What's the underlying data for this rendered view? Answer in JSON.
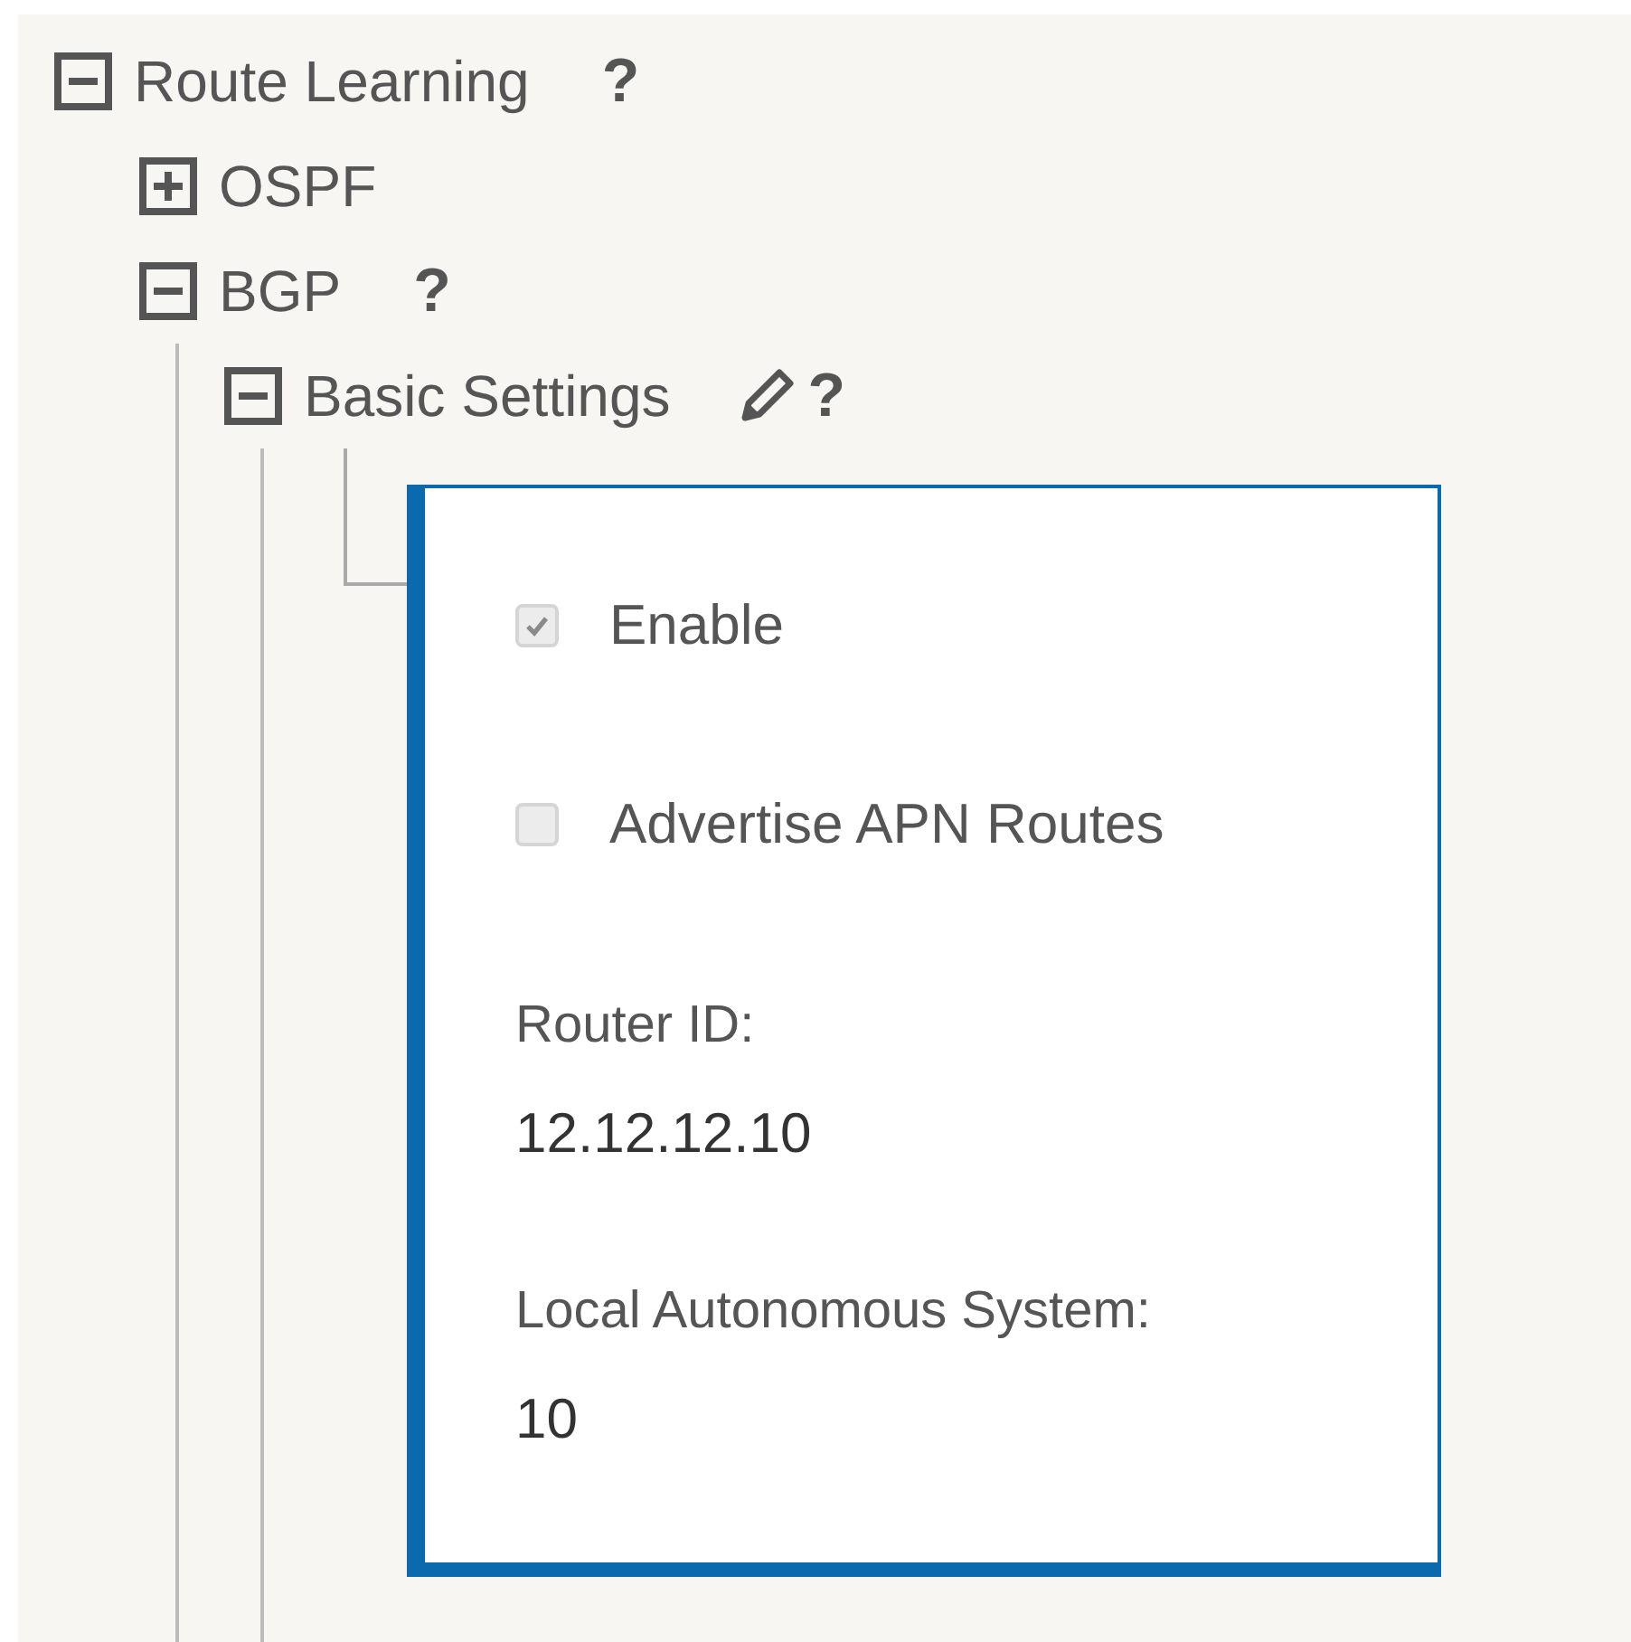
{
  "tree": [
    {
      "label": "Route Learning",
      "expanded": true,
      "help": "?",
      "children": [
        {
          "label": "OSPF",
          "expanded": false
        },
        {
          "label": "BGP",
          "expanded": true,
          "help": "?",
          "children": [
            {
              "label": "Basic Settings",
              "expanded": true,
              "editable": true,
              "help": "?",
              "panel": {
                "fields": [
                  {
                    "kind": "checkbox",
                    "label": "Enable",
                    "checked": true,
                    "disabled": true
                  },
                  {
                    "kind": "checkbox",
                    "label": "Advertise APN Routes",
                    "checked": false,
                    "disabled": true
                  },
                  {
                    "kind": "value",
                    "label": "Router ID:",
                    "value": "12.12.12.10"
                  },
                  {
                    "kind": "value",
                    "label": "Local Autonomous System:",
                    "value": "10"
                  }
                ]
              }
            }
          ]
        }
      ]
    }
  ]
}
